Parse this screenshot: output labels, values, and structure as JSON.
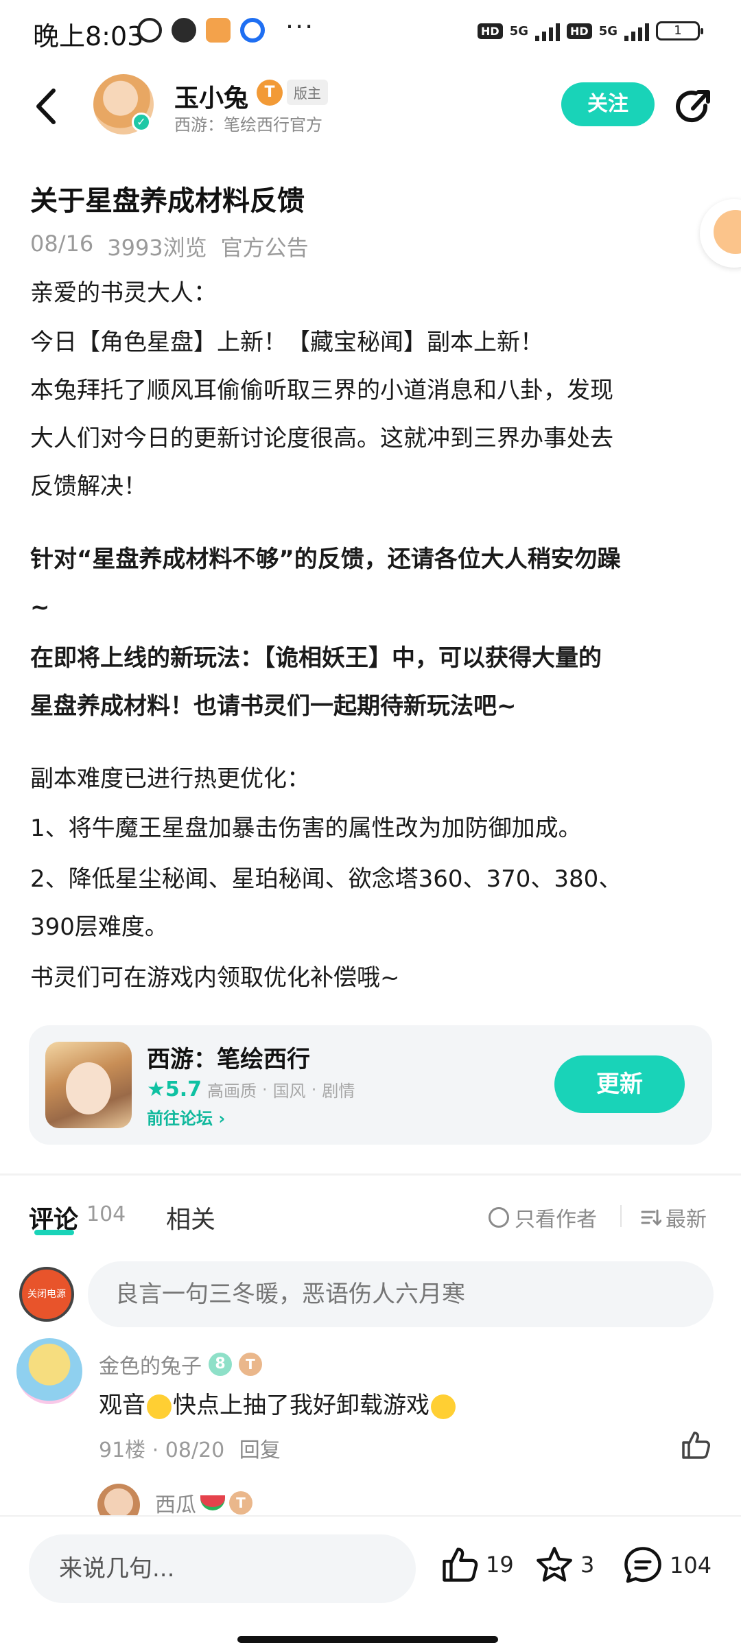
{
  "status_bar": {
    "time": "晚上8:03",
    "battery": "1",
    "network1": "5G",
    "network2": "5G",
    "hd": "HD"
  },
  "header": {
    "author_name": "玉小兔",
    "level": "T",
    "role": "版主",
    "author_sub": "西游：笔绘西行官方",
    "follow_label": "关注"
  },
  "article": {
    "title": "关于星盘养成材料反馈",
    "date": "08/16",
    "views": "3993浏览",
    "category": "官方公告",
    "p1": "亲爱的书灵大人：",
    "p2": "今日【角色星盘】上新！【藏宝秘闻】副本上新！",
    "p3a": "本兔拜托了顺风耳偷偷听取三界的小道消息和八卦，发现",
    "p3b": "大人们对今日的更新讨论度很高。这就冲到三界办事处去",
    "p3c": "反馈解决！",
    "p4a": "针对“星盘养成材料不够”的反馈，还请各位大人稍安勿躁",
    "p4b": "~",
    "p5a": "在即将上线的新玩法：【诡相妖王】中，可以获得大量的",
    "p5b": "星盘养成材料！也请书灵们一起期待新玩法吧~",
    "p6": "副本难度已进行热更优化：",
    "p7": "1、将牛魔王星盘加暴击伤害的属性改为加防御加成。",
    "p8a": "2、降低星尘秘闻、星珀秘闻、欲念塔360、370、380、",
    "p8b": "390层难度。",
    "p9": "书灵们可在游戏内领取优化补偿哦~"
  },
  "game_card": {
    "name": "西游：笔绘西行",
    "rating": "★5.7",
    "tags": [
      "高画质",
      "国风",
      "剧情"
    ],
    "forum_link": "前往论坛 ›",
    "update_label": "更新"
  },
  "comments_header": {
    "tab_comments": "评论",
    "count": "104",
    "tab_related": "相关",
    "author_only": "只看作者",
    "sort": "最新"
  },
  "comment_input": {
    "placeholder": "良言一句三冬暖，恶语伤人六月寒",
    "my_avatar_text": "关闭电源"
  },
  "comments": [
    {
      "user": "金色的兔子",
      "level": "8",
      "text_a": "观音",
      "text_b": "快点上抽了我好卸载游戏",
      "floor": "91楼 · 08/20",
      "reply": "回复"
    }
  ],
  "reply_preview": {
    "user": "西瓜",
    "level": "T"
  },
  "bottom_bar": {
    "say_placeholder": "来说几句...",
    "likes": "19",
    "stars": "3",
    "comments": "104"
  },
  "colors": {
    "accent": "#19d3b8",
    "text": "#1a1a1a",
    "muted": "#9a9a9a"
  }
}
